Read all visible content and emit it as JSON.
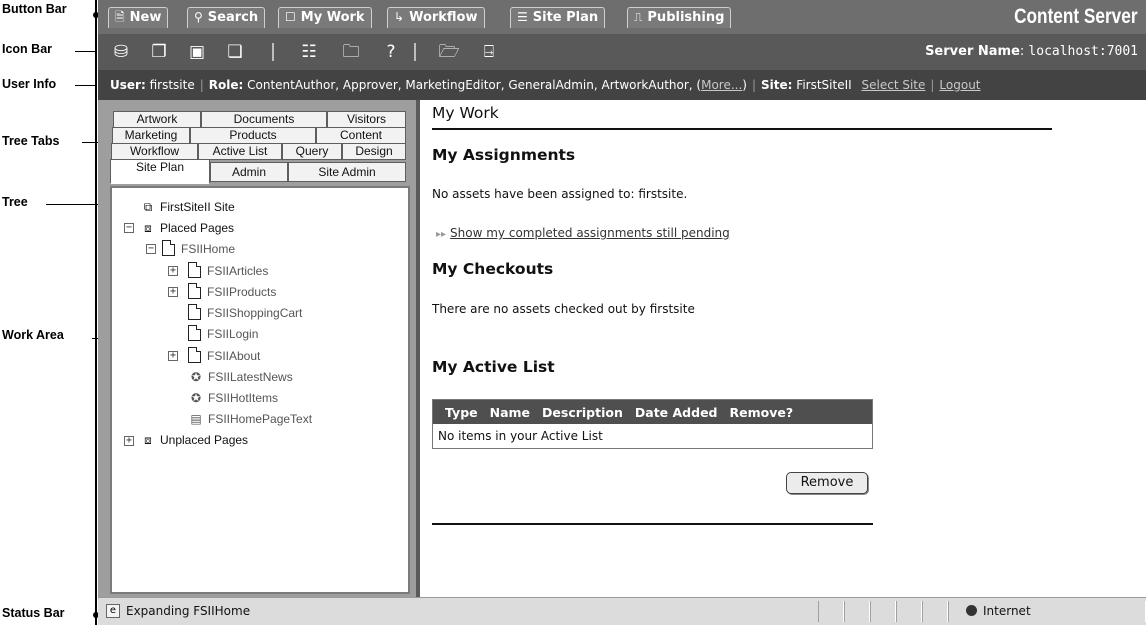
{
  "annotations": {
    "button_bar": "Button Bar",
    "icon_bar": "Icon Bar",
    "user_info": "User Info",
    "tree_tabs": "Tree Tabs",
    "tree": "Tree",
    "work_area": "Work Area",
    "status_bar": "Status Bar"
  },
  "button_bar": {
    "tabs": [
      {
        "icon": "new-doc-icon",
        "label": "New"
      },
      {
        "icon": "search-icon",
        "label": "Search"
      },
      {
        "icon": "my-work-icon",
        "label": "My Work"
      },
      {
        "icon": "workflow-icon",
        "label": "Workflow"
      },
      {
        "icon": "site-plan-icon",
        "label": "Site Plan"
      },
      {
        "icon": "publishing-icon",
        "label": "Publishing"
      }
    ],
    "brand": "Content Server"
  },
  "icon_bar": {
    "icons": [
      "bookmark-icon",
      "copy-icon",
      "inspect-icon",
      "duplicate-icon",
      "list-icon",
      "folder-icon",
      "help-icon",
      "folder-add-icon",
      "logout-icon"
    ],
    "help_glyph": "?",
    "server_label": "Server Name",
    "server_value": "localhost:7001"
  },
  "user_info": {
    "user_label": "User:",
    "user": "firstsite",
    "role_label": "Role:",
    "roles": "ContentAuthor, Approver, MarketingEditor, GeneralAdmin, ArtworkAuthor, (",
    "more": "More...",
    "roles_close": ")",
    "site_label": "Site:",
    "site": "FirstSiteII",
    "select_site": "Select Site",
    "logout": "Logout"
  },
  "tree_tabs": {
    "row1": [
      "Artwork",
      "Documents",
      "Visitors"
    ],
    "row2": [
      "Marketing",
      "Products",
      "Content"
    ],
    "row3": [
      "Workflow",
      "Active List",
      "Query",
      "Design"
    ],
    "row4": [
      "Site Plan",
      "Admin",
      "Site Admin"
    ],
    "active": "Site Plan"
  },
  "tree": {
    "root": "FirstSiteII Site",
    "placed": "Placed Pages",
    "home": "FSIIHome",
    "articles": "FSIIArticles",
    "products": "FSIIProducts",
    "cart": "FSIIShoppingCart",
    "login": "FSIILogin",
    "about": "FSIIAbout",
    "news": "FSIILatestNews",
    "hot": "FSIIHotItems",
    "hometext": "FSIIHomePageText",
    "unplaced": "Unplaced Pages",
    "expand_glyph": "+",
    "collapse_glyph": "−"
  },
  "work": {
    "title": "My Work",
    "assign_heading": "My Assignments",
    "assign_text": "No assets have been assigned to: firstsite.",
    "pending_link": "Show my completed assignments still pending",
    "checkout_heading": "My Checkouts",
    "checkout_text": "There are no assets checked out by firstsite",
    "active_heading": "My Active List",
    "table": {
      "columns": [
        "Type",
        "Name",
        "Description",
        "Date Added",
        "Remove?"
      ],
      "empty": "No items in your Active List"
    },
    "remove_button": "Remove"
  },
  "status_bar": {
    "text": "Expanding FSIIHome",
    "zone": "Internet"
  }
}
